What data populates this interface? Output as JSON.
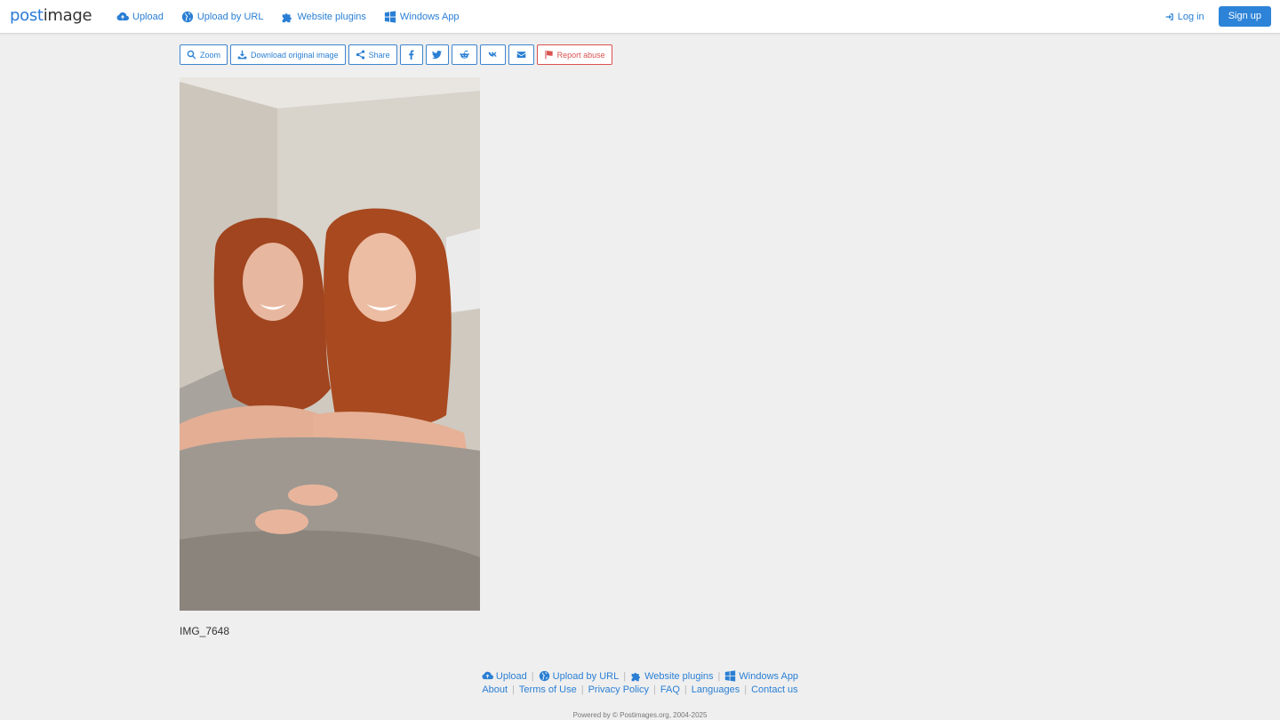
{
  "brand": {
    "part1": "post",
    "part2": "image"
  },
  "nav": {
    "upload": "Upload",
    "upload_by_url": "Upload by URL",
    "website_plugins": "Website plugins",
    "windows_app": "Windows App",
    "log_in": "Log in",
    "sign_up": "Sign up"
  },
  "toolbar": {
    "zoom": "Zoom",
    "download": "Download original image",
    "share": "Share",
    "report": "Report abuse",
    "icons": [
      "search-icon",
      "download-icon",
      "share-icon",
      "facebook-icon",
      "twitter-icon",
      "reddit-icon",
      "vk-icon",
      "email-icon",
      "flag-icon"
    ]
  },
  "image": {
    "filename": "IMG_7648"
  },
  "footer": {
    "upload": "Upload",
    "upload_by_url": "Upload by URL",
    "website_plugins": "Website plugins",
    "windows_app": "Windows App",
    "about": "About",
    "terms": "Terms of Use",
    "privacy": "Privacy Policy",
    "faq": "FAQ",
    "languages": "Languages",
    "contact": "Contact us",
    "powered": "Powered by © Postimages.org, 2004-2025"
  },
  "colors": {
    "accent": "#2a7fd4",
    "danger": "#d9534f",
    "background": "#efefef"
  }
}
